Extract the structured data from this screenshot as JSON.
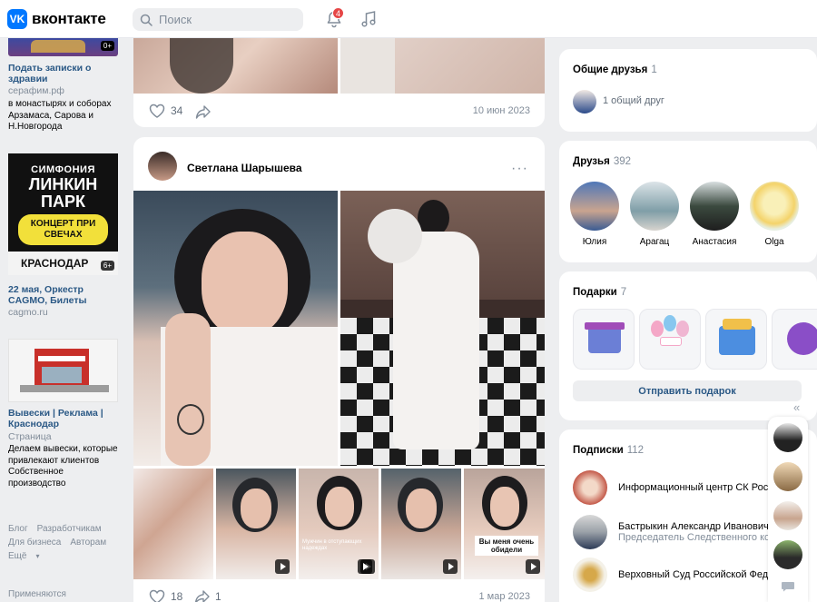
{
  "app": {
    "logo_mark": "VK",
    "logo_text": "вконтакте"
  },
  "header": {
    "search_placeholder": "Поиск",
    "notifications_count": "4",
    "icons": [
      "bell-icon",
      "music-note-icon"
    ]
  },
  "ads": [
    {
      "title": "Подать записки о здравии",
      "domain": "серафим.рф",
      "text": "в монастырях и соборах Арзамаса, Сарова и Н.Новгорода",
      "badge": "0+"
    },
    {
      "image_text_1": "СИМФОНИЯ",
      "image_text_2": "ЛИНКИН ПАРК",
      "image_text_3": "КОНЦЕРТ ПРИ СВЕЧАХ",
      "image_text_4": "КРАСНОДАР",
      "badge": "6+",
      "title": "22 мая, Оркестр CAGMO, Билеты",
      "domain": "cagmo.ru"
    },
    {
      "title": "Вывески | Реклама | Краснодар",
      "domain": "Страница",
      "text": "Делаем вывески, которые привлекают клиентов Собственное производство"
    }
  ],
  "footer": {
    "links": [
      "Блог",
      "Разработчикам",
      "Для бизнеса",
      "Авторам",
      "Ещё"
    ],
    "applied": "Применяются"
  },
  "post1": {
    "likes": "34",
    "date": "10 июн 2023"
  },
  "post2": {
    "author": "Светлана Шарышева",
    "more": "···",
    "likes": "18",
    "shares": "1",
    "date": "1 мар 2023",
    "thumb_captions": {
      "t4": "Мужчин в отступающих надеждах",
      "t5": "Вы меня очень обидели"
    }
  },
  "common_friends": {
    "title": "Общие друзья",
    "count": "1",
    "item": "1 общий друг"
  },
  "friends": {
    "title": "Друзья",
    "count": "392",
    "items": [
      "Юлия",
      "Арагац",
      "Анастасия",
      "Olga"
    ]
  },
  "gifts": {
    "title": "Подарки",
    "count": "7",
    "button": "Отправить подарок"
  },
  "subscriptions": {
    "title": "Подписки",
    "count": "112",
    "items": [
      {
        "name": "Информационный центр СК России",
        "desc": ""
      },
      {
        "name": "Бастрыкин Александр Иванович",
        "desc": "Председатель Следственного комитета"
      },
      {
        "name": "Верховный Суд Российской Федерации",
        "desc": ""
      }
    ]
  },
  "colors": {
    "accent": "#0077ff",
    "link": "#2a5885",
    "badge": "#e64646",
    "bg": "#edeef0"
  }
}
